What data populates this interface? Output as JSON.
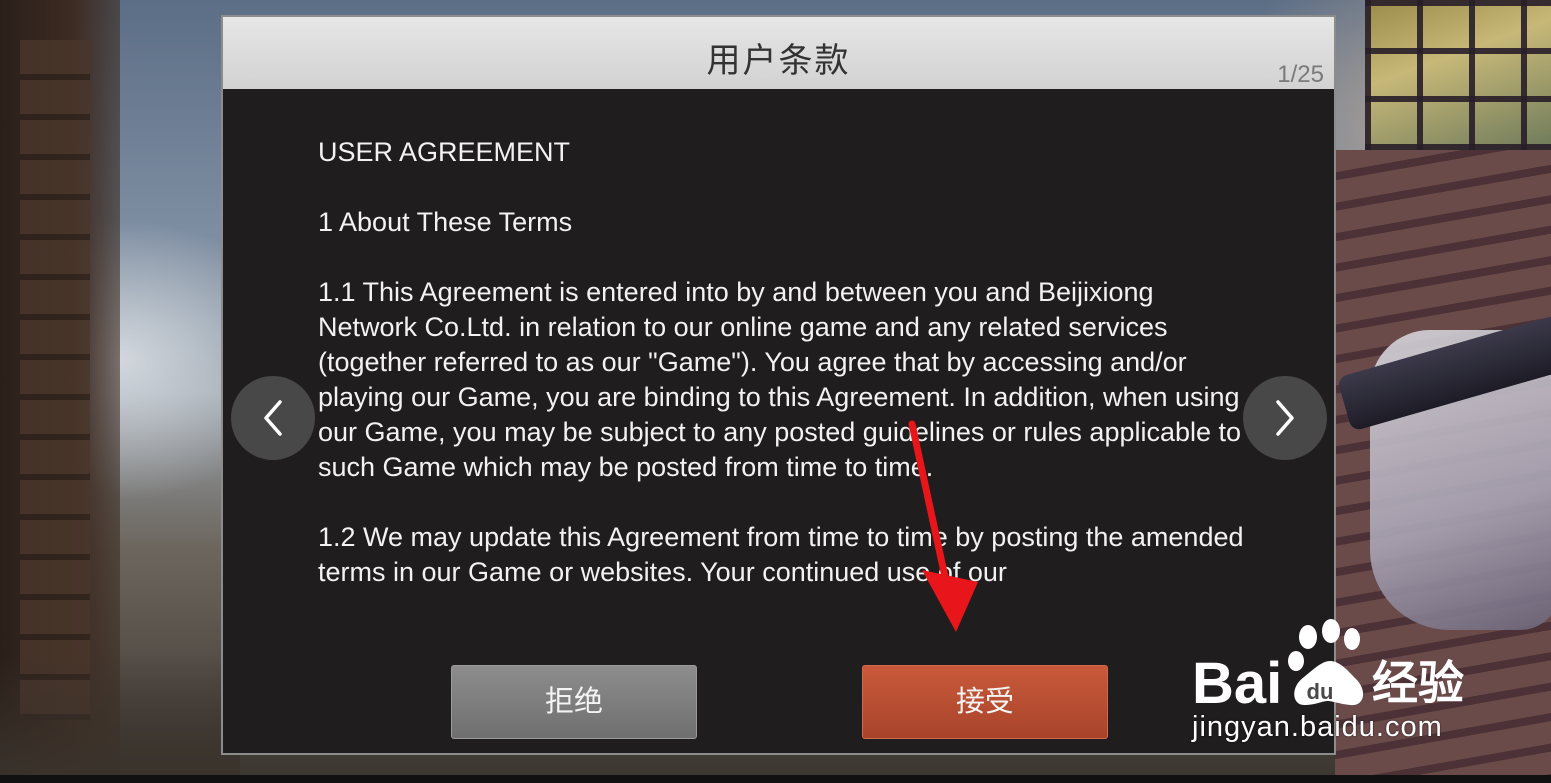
{
  "dialog": {
    "title": "用户条款",
    "page_counter": "1/25",
    "content": {
      "heading": "USER AGREEMENT",
      "section_title": "1 About These Terms",
      "paragraph_1_1": "1.1 This Agreement is entered into by and between you and Beijixiong Network Co.Ltd. in relation to our online game and any related services (together referred to as our \"Game\"). You agree that by accessing and/or playing our Game, you are binding to this Agreement. In addition, when using our Game, you may be subject to any posted guidelines or rules applicable to such Game which may be posted from time to time.",
      "paragraph_1_2": "1.2 We may update this Agreement from time to time by posting the amended terms in our Game or websites. Your continued use of our"
    },
    "buttons": {
      "reject_label": "拒绝",
      "accept_label": "接受"
    }
  },
  "nav": {
    "prev_icon": "chevron-left-icon",
    "next_icon": "chevron-right-icon"
  },
  "annotation": {
    "arrow_color": "#e8151b"
  },
  "watermark": {
    "logo_text": "Bai 经验",
    "url": "jingyan.baidu.com"
  },
  "colors": {
    "accept": "#b94d32",
    "reject": "#7c7c7c",
    "dialog_bg": "#1f1d1e",
    "header_bg": "#dcdcdc"
  }
}
